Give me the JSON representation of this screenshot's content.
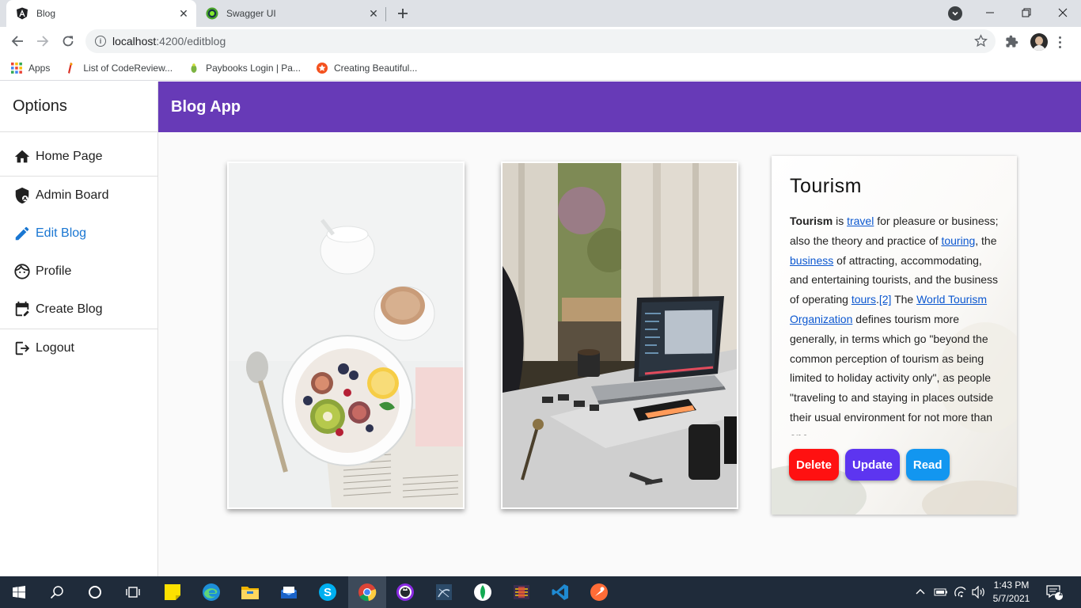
{
  "browser": {
    "tabs": [
      {
        "title": "Blog",
        "icon": "angular-icon",
        "active": true
      },
      {
        "title": "Swagger UI",
        "icon": "swagger-icon",
        "active": false
      }
    ],
    "url_host": "localhost",
    "url_rest": ":4200/editblog",
    "bookmarks": [
      {
        "label": "Apps",
        "icon": "apps-grid-icon"
      },
      {
        "label": "List of CodeReview...",
        "icon": "red-flag-icon"
      },
      {
        "label": "Paybooks Login | Pa...",
        "icon": "paybooks-icon"
      },
      {
        "label": "Creating Beautiful...",
        "icon": "orange-star-icon"
      }
    ]
  },
  "sidebar": {
    "title": "Options",
    "items": [
      {
        "label": "Home Page",
        "icon": "home-icon"
      },
      {
        "label": "Admin Board",
        "icon": "admin-shield-icon"
      },
      {
        "label": "Edit Blog",
        "icon": "pencil-icon",
        "active": true
      },
      {
        "label": "Profile",
        "icon": "face-icon"
      },
      {
        "label": "Create Blog",
        "icon": "calendar-edit-icon"
      },
      {
        "label": "Logout",
        "icon": "logout-icon"
      }
    ]
  },
  "appbar": {
    "title": "Blog App"
  },
  "card": {
    "title": "Tourism",
    "text": {
      "t1": "Tourism",
      "t2": " is ",
      "l1": "travel",
      "t3": " for pleasure or business; also the theory and practice of ",
      "l2": "touring",
      "t4": ", the ",
      "l3": "business",
      "t5": " of attracting, accommodating, and entertaining tourists, and the business of operating ",
      "l4": "tours",
      "t6": ".",
      "l5": "[2]",
      "t7": " The ",
      "l6": "World Tourism Organization",
      "t8": " defines tourism more generally, in terms which go \"beyond the common perception of tourism as being limited to holiday activity only\", as people \"traveling to and staying in places outside their usual environment for not more than one"
    },
    "buttons": {
      "delete": "Delete",
      "update": "Update",
      "read": "Read"
    }
  },
  "colors": {
    "appbar": "#673ab7",
    "delete": "#ff1111",
    "update": "#5d35f0",
    "read": "#1296f0",
    "active_nav": "#1976d2"
  },
  "taskbar": {
    "time": "1:43 PM",
    "date": "5/7/2021",
    "notifications": "1"
  }
}
